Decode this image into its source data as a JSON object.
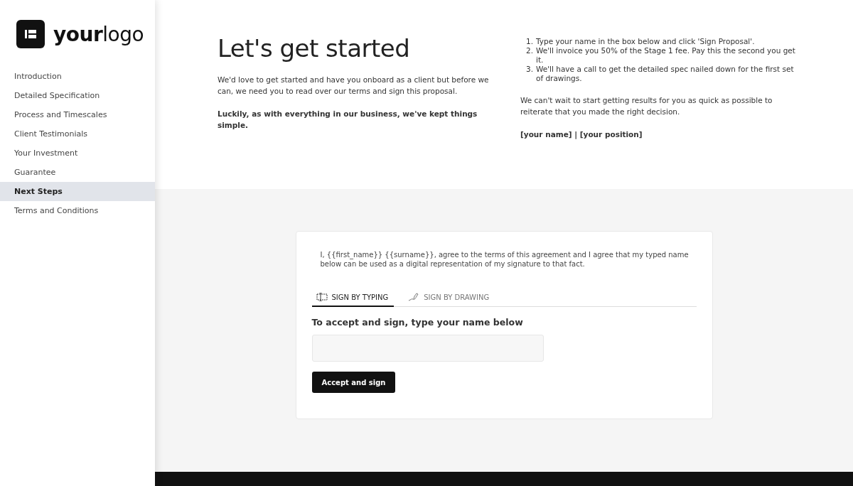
{
  "logo": {
    "text": "**your**logo"
  },
  "sidebar": {
    "items": [
      {
        "label": "Introduction",
        "selected": false
      },
      {
        "label": "Detailed Specification",
        "selected": false
      },
      {
        "label": "Process and Timescales",
        "selected": false
      },
      {
        "label": "Client Testimonials",
        "selected": false
      },
      {
        "label": "Your Investment",
        "selected": false
      },
      {
        "label": "Guarantee",
        "selected": false
      },
      {
        "label": "Next Steps",
        "selected": true
      },
      {
        "label": "Terms and Conditions",
        "selected": false
      }
    ]
  },
  "intro": {
    "title": "Let's get started",
    "paragraph": "We'd love to get started and have you onboard as a client but before we can, we need you to read over our terms and sign this proposal.",
    "emphasis": "Luckily, as with everything in our business, we've kept things simple."
  },
  "steps": [
    {
      "number": "1.",
      "text": "Type your name in the box below and click 'Sign Proposal'."
    },
    {
      "number": "2.",
      "text": "We'll invoice you 50% of the Stage 1 fee. Pay this the second you get it."
    },
    {
      "number": "3.",
      "text": "We'll have a call to get the detailed spec nailed down for the first set of drawings."
    }
  ],
  "closing": "We can't wait to start getting results for you as quick as possible to reiterate that you made the right decision.",
  "signoff": "[your name] | [your position]",
  "signature_card": {
    "agreement": "I, {{first_name}} {{surname}}, agree to the terms of this agreement and I agree that my typed name below can be used as a digital representation of my signature to that fact.",
    "tabs": [
      {
        "kind": "typing",
        "label": "SIGN BY TYPING",
        "selected": true
      },
      {
        "kind": "drawing",
        "label": "SIGN BY DRAWING",
        "selected": false
      }
    ],
    "field_label": "To accept and sign, type your name below",
    "button": "Accept and sign"
  }
}
